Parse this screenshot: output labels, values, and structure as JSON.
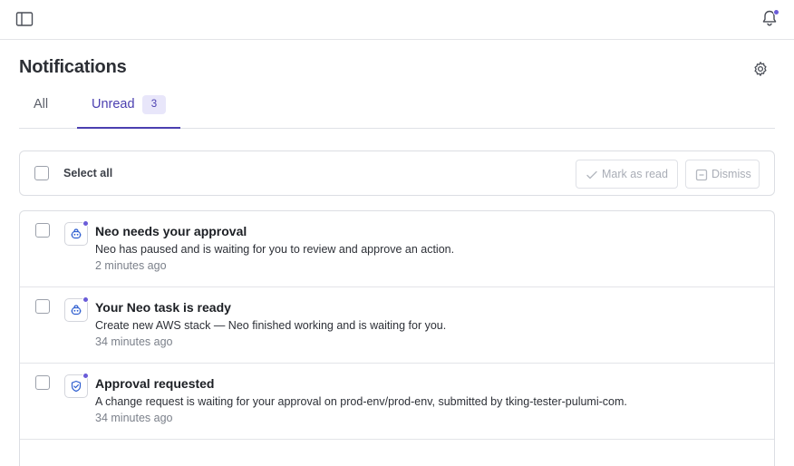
{
  "page": {
    "title": "Notifications"
  },
  "tabs": [
    {
      "label": "All"
    },
    {
      "label": "Unread",
      "count": "3"
    }
  ],
  "bulk": {
    "select_all_label": "Select all",
    "mark_read_label": "Mark as read",
    "dismiss_label": "Dismiss"
  },
  "notifications": [
    {
      "title": "Neo needs your approval",
      "body": "Neo has paused and is waiting for you to review and approve an action.",
      "time": "2 minutes ago",
      "icon": "neo-robot-icon",
      "unread": true
    },
    {
      "title": "Your Neo task is ready",
      "body": "Create new AWS stack — Neo finished working and is waiting for you.",
      "time": "34 minutes ago",
      "icon": "neo-robot-icon",
      "unread": true
    },
    {
      "title": "Approval requested",
      "body": "A change request is waiting for your approval on prod-env/prod-env, submitted by tking-tester-pulumi-com.",
      "time": "34 minutes ago",
      "icon": "shield-check-icon",
      "unread": true
    }
  ],
  "colors": {
    "accent": "#4b3fb0",
    "unread_dot": "#6a5cd8",
    "icon_blue": "#2f5fd0"
  },
  "icons": {
    "topbar_left": "sidebar-toggle-icon",
    "topbar_right": "bell-icon",
    "settings": "gear-icon"
  }
}
